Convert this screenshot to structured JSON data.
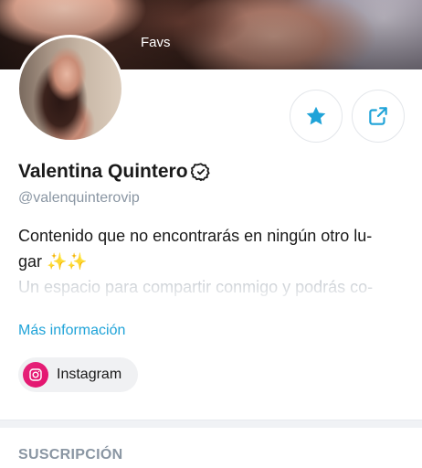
{
  "cover": {
    "label": "Favs"
  },
  "profile": {
    "name": "Valentina Quintero",
    "handle": "@valenquinterovip",
    "bio_line1": "Contenido que no encontrarás en ningún otro lu-",
    "bio_line2": "gar ✨✨",
    "bio_line3": "Un espacio para compartir conmigo y podrás co-",
    "more_info": "Más información"
  },
  "social": {
    "instagram_label": "Instagram"
  },
  "section": {
    "subscription_title": "SUSCRIPCIÓN"
  },
  "colors": {
    "accent": "#1fa3d8",
    "instagram": "#e3116c",
    "muted": "#8a96a3"
  },
  "icons": [
    "star-icon",
    "share-icon",
    "verified-icon",
    "instagram-icon"
  ]
}
